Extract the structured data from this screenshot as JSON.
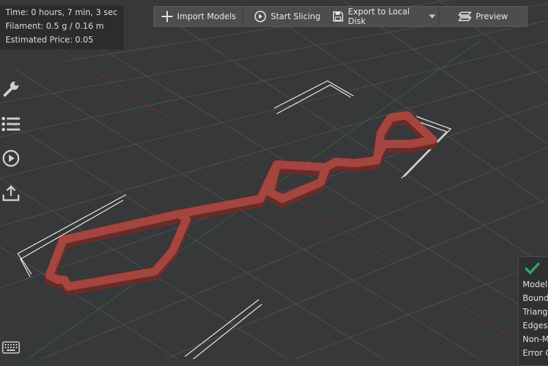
{
  "info": {
    "time": "Time: 0 hours, 7 min, 3 sec",
    "filament": "Filament: 0.5 g / 0.16 m",
    "price": "Estimated Price: 0.05"
  },
  "toolbar": {
    "import_label": "Import Models",
    "slice_label": "Start Slicing",
    "export_label": "Export to Local Disk",
    "preview_label": "Preview"
  },
  "sidebar": {
    "icons": [
      "wrench-icon",
      "list-icon",
      "play-icon",
      "upload-icon"
    ]
  },
  "model_panel": {
    "rows": [
      "Model:",
      "Boundi",
      "Triangl",
      "Edges:",
      "Non-M",
      "Error C"
    ]
  },
  "colors": {
    "background": "#363839",
    "grid": "#4e5153",
    "model": "#a4453f",
    "x_axis": "#7a2f2f",
    "y_axis": "#2f6a2f",
    "check": "#2fa86a"
  }
}
